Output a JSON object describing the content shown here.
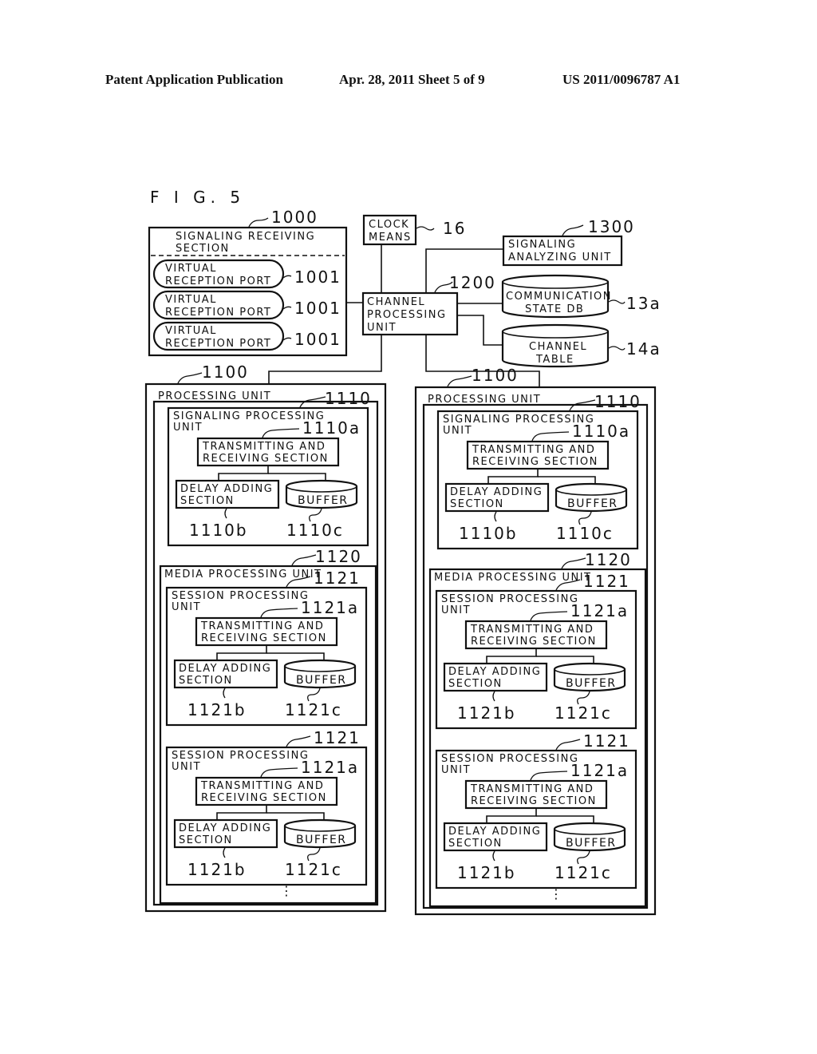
{
  "header": {
    "left": "Patent Application Publication",
    "middle": "Apr. 28, 2011  Sheet 5 of 9",
    "right": "US 2011/0096787 A1"
  },
  "figure": {
    "title": "F I G. 5",
    "signaling_receiving": {
      "ref": "1000",
      "label_line1": "SIGNALING RECEIVING",
      "label_line2": "SECTION",
      "ports": [
        {
          "line1": "VIRTUAL",
          "line2": "RECEPTION PORT",
          "ref": "1001"
        },
        {
          "line1": "VIRTUAL",
          "line2": "RECEPTION PORT",
          "ref": "1001"
        },
        {
          "line1": "VIRTUAL",
          "line2": "RECEPTION PORT",
          "ref": "1001"
        }
      ]
    },
    "clock": {
      "line1": "CLOCK",
      "line2": "MEANS",
      "ref": "16"
    },
    "channel_processing": {
      "line1": "CHANNEL",
      "line2": "PROCESSING",
      "line3": "UNIT",
      "ref": "1200"
    },
    "signaling_analyzing": {
      "line1": "SIGNALING",
      "line2": "ANALYZING UNIT",
      "ref": "1300"
    },
    "comm_state_db": {
      "line1": "COMMUNICATION",
      "line2": "STATE DB",
      "ref": "13a"
    },
    "channel_table": {
      "line1": "CHANNEL",
      "line2": "TABLE",
      "ref": "14a"
    },
    "processing_units": [
      {
        "ref": "1100",
        "label": "PROCESSING UNIT",
        "signaling": {
          "ref": "1110",
          "line1": "SIGNALING PROCESSING",
          "line2": "UNIT",
          "trx": {
            "ref": "1110a",
            "line1": "TRANSMITTING AND",
            "line2": "RECEIVING SECTION"
          },
          "delay": {
            "ref": "1110b",
            "line1": "DELAY ADDING",
            "line2": "SECTION"
          },
          "buffer": {
            "ref": "1110c",
            "label": "BUFFER"
          }
        },
        "media": {
          "ref": "1120",
          "label": "MEDIA PROCESSING UNIT",
          "sessions": [
            {
              "ref": "1121",
              "line1": "SESSION PROCESSING",
              "line2": "UNIT",
              "trx": {
                "ref": "1121a",
                "line1": "TRANSMITTING AND",
                "line2": "RECEIVING SECTION"
              },
              "delay": {
                "ref": "1121b",
                "line1": "DELAY ADDING",
                "line2": "SECTION"
              },
              "buffer": {
                "ref": "1121c",
                "label": "BUFFER"
              }
            },
            {
              "ref": "1121",
              "line1": "SESSION PROCESSING",
              "line2": "UNIT",
              "trx": {
                "ref": "1121a",
                "line1": "TRANSMITTING AND",
                "line2": "RECEIVING SECTION"
              },
              "delay": {
                "ref": "1121b",
                "line1": "DELAY ADDING",
                "line2": "SECTION"
              },
              "buffer": {
                "ref": "1121c",
                "label": "BUFFER"
              }
            }
          ],
          "ellipsis": "⋮"
        }
      },
      {
        "ref": "1100",
        "label": "PROCESSING UNIT",
        "signaling": {
          "ref": "1110",
          "line1": "SIGNALING PROCESSING",
          "line2": "UNIT",
          "trx": {
            "ref": "1110a",
            "line1": "TRANSMITTING AND",
            "line2": "RECEIVING SECTION"
          },
          "delay": {
            "ref": "1110b",
            "line1": "DELAY ADDING",
            "line2": "SECTION"
          },
          "buffer": {
            "ref": "1110c",
            "label": "BUFFER"
          }
        },
        "media": {
          "ref": "1120",
          "label": "MEDIA PROCESSING UNIT",
          "sessions": [
            {
              "ref": "1121",
              "line1": "SESSION PROCESSING",
              "line2": "UNIT",
              "trx": {
                "ref": "1121a",
                "line1": "TRANSMITTING AND",
                "line2": "RECEIVING SECTION"
              },
              "delay": {
                "ref": "1121b",
                "line1": "DELAY ADDING",
                "line2": "SECTION"
              },
              "buffer": {
                "ref": "1121c",
                "label": "BUFFER"
              }
            },
            {
              "ref": "1121",
              "line1": "SESSION PROCESSING",
              "line2": "UNIT",
              "trx": {
                "ref": "1121a",
                "line1": "TRANSMITTING AND",
                "line2": "RECEIVING SECTION"
              },
              "delay": {
                "ref": "1121b",
                "line1": "DELAY ADDING",
                "line2": "SECTION"
              },
              "buffer": {
                "ref": "1121c",
                "label": "BUFFER"
              }
            }
          ],
          "ellipsis": "⋮"
        }
      }
    ]
  }
}
